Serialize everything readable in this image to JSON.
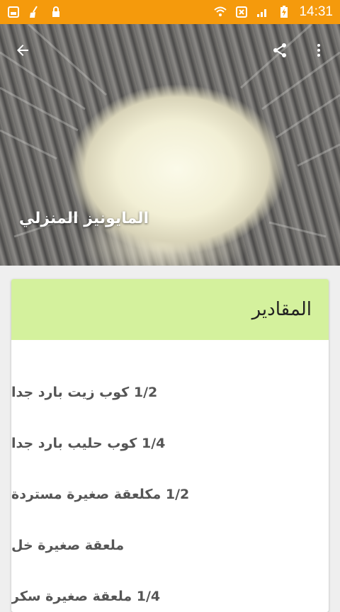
{
  "status_bar": {
    "time": "14:31",
    "left_icons": [
      "image-icon",
      "clean-icon",
      "lock-icon"
    ],
    "right_icons": [
      "wifi-icon",
      "data-icon",
      "signal-icon",
      "battery-charging-icon"
    ],
    "background": "#f59a0c"
  },
  "app_bar": {
    "actions": [
      "back-arrow-icon",
      "share-icon",
      "more-vert-icon"
    ]
  },
  "hero": {
    "title": "المايونيز المنزلي"
  },
  "card": {
    "header": "المقادير",
    "header_color": "#d4f19d",
    "items": [
      "1/2 كوب زيت بارد جدا",
      "1/4 كوب حليب بارد جدا",
      "1/2 مكلعقة صغيرة مستردة",
      "ملعقة صغيرة خل",
      "1/4 ملعقة صغيرة سكر"
    ]
  }
}
